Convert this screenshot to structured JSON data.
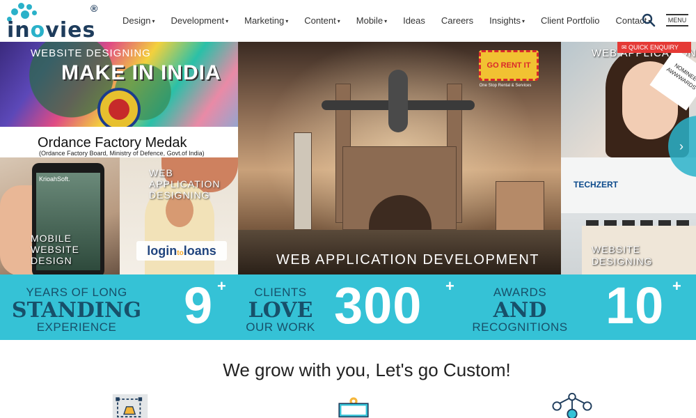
{
  "brand": {
    "name_pre": "in",
    "name_o": "o",
    "name_post": "vies",
    "registered": "®"
  },
  "nav": [
    {
      "label": "Design",
      "caret": "▾"
    },
    {
      "label": "Development",
      "caret": "▾"
    },
    {
      "label": "Marketing",
      "caret": "▾"
    },
    {
      "label": "Content",
      "caret": "▾"
    },
    {
      "label": "Mobile",
      "caret": "▾"
    },
    {
      "label": "Ideas",
      "caret": ""
    },
    {
      "label": "Careers",
      "caret": ""
    },
    {
      "label": "Insights",
      "caret": "▾"
    },
    {
      "label": "Client Portfolio",
      "caret": ""
    },
    {
      "label": "Contact",
      "caret": "▾"
    }
  ],
  "menu_label": "MENU",
  "hero": {
    "makeindia": {
      "caption": "WEBSITE DESIGNING",
      "headline": "MAKE IN INDIA",
      "client": "Ordance Factory Medak",
      "client_sub": "(Ordance Factory Board, Ministry of Defence, Govt.of India)"
    },
    "mobile": {
      "brand": "KrioahSoft.",
      "caption": "MOBILE WEBSITE DESIGN"
    },
    "loans": {
      "caption": "WEB APPLICATION DESIGNING",
      "logo_a": "login",
      "logo_to": "to",
      "logo_b": "loans"
    },
    "charminar": {
      "caption": "WEB APPLICATION DEVELOPMENT",
      "badge": "GO RENT IT",
      "badge_sub": "One Stop Rental & Services"
    },
    "webapp": {
      "caption": "WEB APPLICATION",
      "award": "NOMINEE AWWWARDS"
    },
    "techzert": {
      "logo": "TECHZERT",
      "caption": "WEBSITE DESIGNING"
    },
    "quick_enquiry": "QUICK ENQUIRY",
    "next_arrow": "›"
  },
  "stats": [
    {
      "line1": "YEARS OF LONG",
      "big": "STANDING",
      "line3": "EXPERIENCE",
      "number": "9",
      "plus": "+"
    },
    {
      "line1": "CLIENTS",
      "big": "LOVE",
      "line3": "OUR WORK",
      "number": "300",
      "plus": "+"
    },
    {
      "line1": "AWARDS",
      "big": "AND",
      "line3": "RECOGNITIONS",
      "number": "10",
      "plus": "+"
    }
  ],
  "tagline": "We grow with you, Let's go Custom!",
  "icons": {
    "search": "search-icon",
    "design_service": "pen-tool-icon",
    "dev_service": "monitor-gear-icon",
    "network_service": "network-icon"
  },
  "colors": {
    "accent": "#35c2d6",
    "stat_text": "#17506a",
    "brand_dark": "#1e3c5c",
    "quick_enquiry": "#e53935"
  }
}
